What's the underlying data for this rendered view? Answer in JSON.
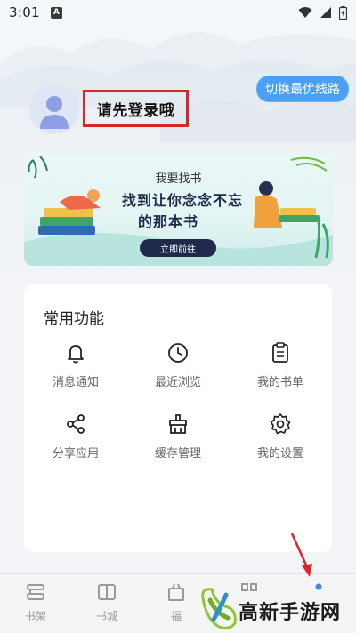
{
  "status_bar": {
    "time": "3:01",
    "notif_glyph": "A"
  },
  "header": {
    "route_button_label": "切换最优线路",
    "login_prompt": "请先登录哦"
  },
  "banner": {
    "title": "我要找书",
    "slogan_line1": "找到让你念念不忘",
    "slogan_line2": "的那本书",
    "cta_label": "立即前往"
  },
  "functions": {
    "title": "常用功能",
    "items": [
      {
        "label": "消息通知",
        "icon": "bell-icon"
      },
      {
        "label": "最近浏览",
        "icon": "clock-icon"
      },
      {
        "label": "我的书单",
        "icon": "clipboard-icon"
      },
      {
        "label": "分享应用",
        "icon": "share-icon"
      },
      {
        "label": "缓存管理",
        "icon": "broom-icon"
      },
      {
        "label": "我的设置",
        "icon": "gear-icon"
      }
    ]
  },
  "tabbar": {
    "items": [
      {
        "label": "书架",
        "icon": "bookshelf-icon"
      },
      {
        "label": "书城",
        "icon": "book-open-icon"
      },
      {
        "label": "福",
        "icon": "gift-icon"
      },
      {
        "label": "",
        "icon": "grid-icon"
      },
      {
        "label": "",
        "icon": "profile-dot-icon"
      }
    ]
  },
  "watermark": {
    "text": "高新手游网"
  },
  "colors": {
    "accent_blue": "#4b9ff5",
    "highlight_red": "#d7262d",
    "banner_navy": "#1f2a4a"
  }
}
